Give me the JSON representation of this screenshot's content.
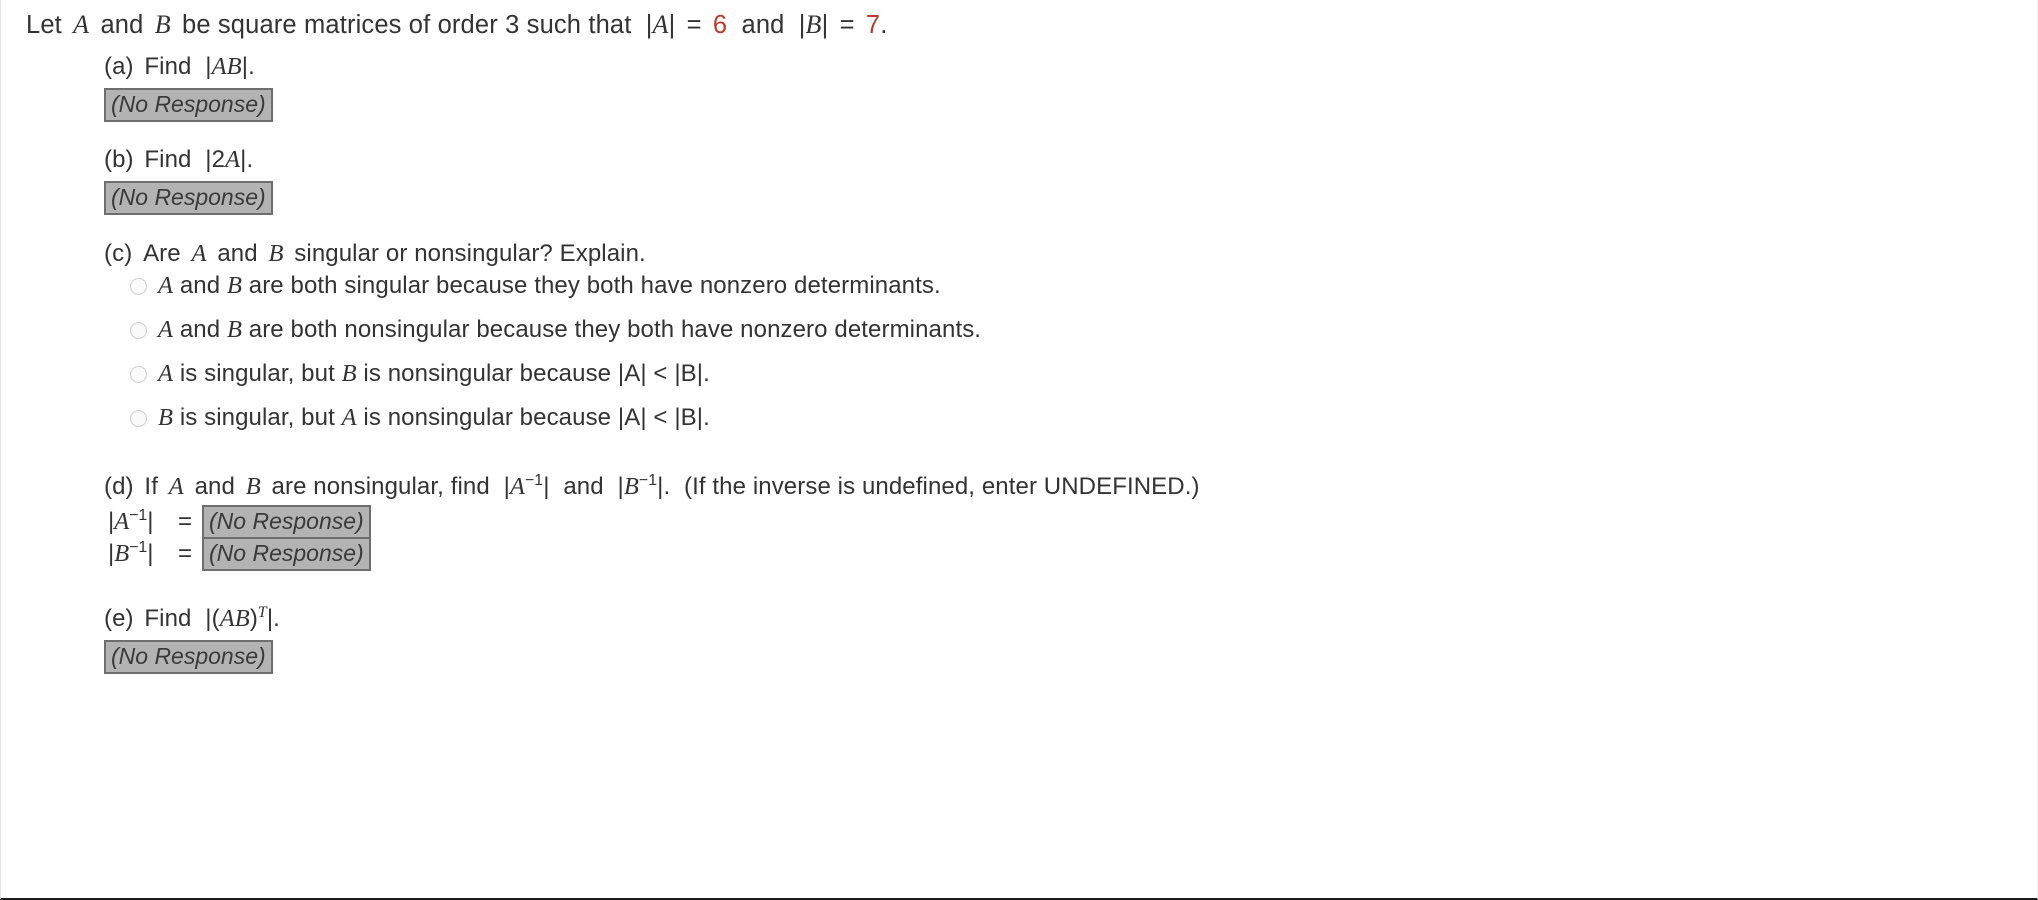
{
  "stem": {
    "text_lead": "Let",
    "var_a": "A",
    "text_and1": "and",
    "var_b": "B",
    "text_mid": "be square matrices of order 3 such that",
    "det_a_open": "|",
    "det_a_var": "A",
    "det_a_close": "|",
    "eq1": "=",
    "val_a": "6",
    "text_and2": "and",
    "det_b_open": "|",
    "det_b_var": "B",
    "det_b_close": "|",
    "eq2": "=",
    "val_b": "7",
    "period": "."
  },
  "parts": {
    "a": {
      "letter": "(a)",
      "verb": "Find",
      "expr_open": "|",
      "expr_var": "AB",
      "expr_close": "|.",
      "answer": "(No Response)"
    },
    "b": {
      "letter": "(b)",
      "verb": "Find",
      "expr_open": "|2",
      "expr_var": "A",
      "expr_close": "|.",
      "answer": "(No Response)"
    },
    "c": {
      "letter": "(c)",
      "q_lead": "Are",
      "var_a": "A",
      "q_and": "and",
      "var_b": "B",
      "q_tail": "singular or nonsingular? Explain.",
      "options": [
        {
          "id": "opt-both-singular",
          "var1": "A",
          "mid1": " and ",
          "var2": "B",
          "tail": " are both singular because they both have nonzero determinants.",
          "selected": false
        },
        {
          "id": "opt-both-nonsingular",
          "var1": "A",
          "mid1": " and ",
          "var2": "B",
          "tail": " are both nonsingular because they both have nonzero determinants.",
          "selected": false
        },
        {
          "id": "opt-a-singular-b-nonsingular",
          "var1": "A",
          "mid1": " is singular, but ",
          "var2": "B",
          "tail": " is nonsingular because |A| < |B|.",
          "selected": false
        },
        {
          "id": "opt-b-singular-a-nonsingular",
          "var1": "B",
          "mid1": " is singular, but ",
          "var2": "A",
          "tail": " is nonsingular because |A| < |B|.",
          "selected": false
        }
      ]
    },
    "d": {
      "letter": "(d)",
      "q_lead": "If",
      "var_a": "A",
      "q_and": "and",
      "var_b": "B",
      "q_mid": "are nonsingular, find",
      "expr1_open": "|",
      "expr1_var": "A",
      "expr1_sup": "−1",
      "expr1_close": "|",
      "q_and2": "and",
      "expr2_open": "|",
      "expr2_var": "B",
      "expr2_sup": "−1",
      "expr2_close": "|.",
      "note": "(If the inverse is undefined, enter UNDEFINED.)",
      "rows": [
        {
          "lhs_open": "|",
          "lhs_var": "A",
          "lhs_sup": "−1",
          "lhs_close": "|",
          "sign": "=",
          "answer": "(No Response)"
        },
        {
          "lhs_open": "|",
          "lhs_var": "B",
          "lhs_sup": "−1",
          "lhs_close": "|",
          "sign": "=",
          "answer": "(No Response)"
        }
      ]
    },
    "e": {
      "letter": "(e)",
      "verb": "Find",
      "expr_open": "|(",
      "expr_var": "AB",
      "expr_mid": ")",
      "expr_sup": "T",
      "expr_close": "|.",
      "answer": "(No Response)"
    }
  },
  "colors": {
    "text": "#333333",
    "value_accent": "#c0392b",
    "noresponse_fill": "#b3b3b3",
    "noresponse_border": "#6e6e6e"
  }
}
